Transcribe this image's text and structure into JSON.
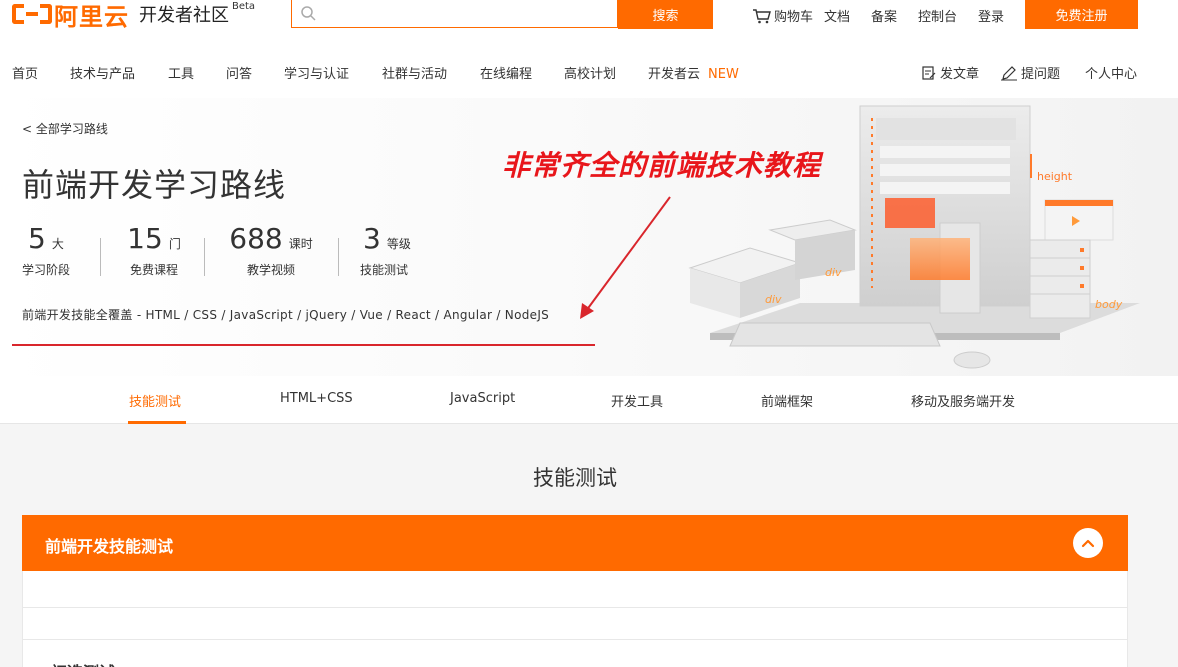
{
  "brand": {
    "name": "阿里云",
    "sub": "开发者社区",
    "beta": "Beta",
    "color": "#ff6a00"
  },
  "search": {
    "placeholder": "",
    "button": "搜索"
  },
  "top_links": {
    "cart": "购物车",
    "docs": "文档",
    "record": "备案",
    "console": "控制台",
    "login": "登录",
    "register": "免费注册"
  },
  "nav": {
    "items": [
      "首页",
      "技术与产品",
      "工具",
      "问答",
      "学习与认证",
      "社群与活动",
      "在线编程",
      "高校计划",
      "开发者云"
    ],
    "new_badge": "NEW",
    "write_article": "发文章",
    "ask_question": "提问题",
    "personal_center": "个人中心"
  },
  "hero": {
    "breadcrumb": "< 全部学习路线",
    "title": "前端开发学习路线",
    "stats": [
      {
        "num": "5",
        "unit": "大",
        "label": "学习阶段"
      },
      {
        "num": "15",
        "unit": "门",
        "label": "免费课程"
      },
      {
        "num": "688",
        "unit": "课时",
        "label": "教学视频"
      },
      {
        "num": "3",
        "unit": "等级",
        "label": "技能测试"
      }
    ],
    "tech_line": "前端开发技能全覆盖 - HTML / CSS / JavaScript / jQuery / Vue / React / Angular / NodeJS",
    "annotation": "非常齐全的前端技术教程",
    "illus_labels": {
      "height": "height",
      "div1": "div",
      "div2": "div",
      "body": "body"
    }
  },
  "tabs": {
    "items": [
      "技能测试",
      "HTML+CSS",
      "JavaScript",
      "开发工具",
      "前端框架",
      "移动及服务端开发"
    ],
    "active_index": 0
  },
  "content": {
    "section_title": "技能测试",
    "panel_title": "前端开发技能测试",
    "panel_sub": "初选测试"
  }
}
